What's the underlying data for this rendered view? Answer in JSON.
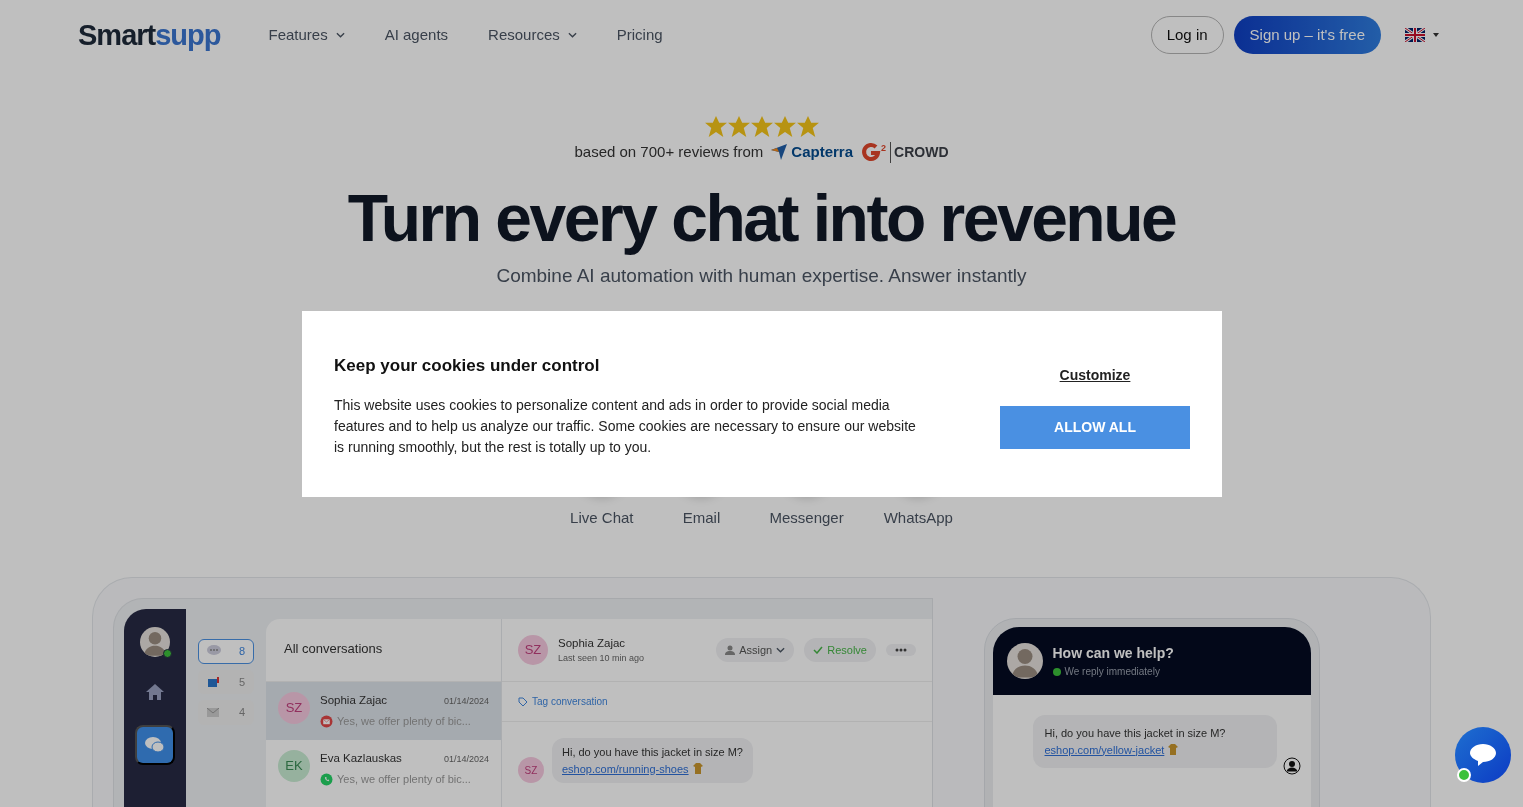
{
  "nav": {
    "logo_dark": "Smart",
    "logo_blue": "supp",
    "items": [
      {
        "label": "Features",
        "dropdown": true
      },
      {
        "label": "AI agents",
        "dropdown": false
      },
      {
        "label": "Resources",
        "dropdown": true
      },
      {
        "label": "Pricing",
        "dropdown": false
      }
    ],
    "login": "Log in",
    "signup": "Sign up – it's free"
  },
  "hero": {
    "stars": 5,
    "reviews_text": "based on 700+ reviews from",
    "capterra": "Capterra",
    "g2_mark": "2",
    "crowd": "CROWD",
    "title": "Turn every chat into revenue",
    "subtitle": "Combine AI automation with human expertise. Answer instantly"
  },
  "channels": [
    {
      "label": "Live Chat"
    },
    {
      "label": "Email"
    },
    {
      "label": "Messenger"
    },
    {
      "label": "WhatsApp"
    }
  ],
  "app": {
    "counts": [
      {
        "kind": "chat",
        "count": "8",
        "selected": true
      },
      {
        "kind": "mailbox",
        "count": "5",
        "selected": false
      },
      {
        "kind": "email",
        "count": "4",
        "selected": false
      }
    ],
    "list_title": "All conversations",
    "conversations": [
      {
        "initials": "SZ",
        "name": "Sophia Zajac",
        "date": "01/14/2024",
        "kind": "email",
        "preview": "Yes, we offer plenty of bic...",
        "selected": true
      },
      {
        "initials": "EK",
        "name": "Eva Kazlauskas",
        "date": "01/14/2024",
        "kind": "whatsapp",
        "preview": "Yes, we offer plenty of bic...",
        "selected": false
      }
    ],
    "chat": {
      "header_initials": "SZ",
      "message_initials": "SZ",
      "name": "Sophia Zajac",
      "last_seen": "Last seen 10 min ago",
      "assign": "Assign",
      "resolve": "Resolve",
      "tag": "Tag conversation",
      "message": "Hi, do you have this jacket in size M?",
      "link": "eshop.com/running-shoes"
    }
  },
  "widget": {
    "title": "How can we help?",
    "status": "We reply immediately",
    "online": true,
    "message": "Hi, do you have this jacket in size M?",
    "link": "eshop.com/yellow-jacket"
  },
  "cookie": {
    "title": "Keep your cookies under control",
    "text": "This website uses cookies to personalize content and ads in order to provide social media features and to help us analyze our traffic. Some cookies are necessary to ensure our website is running smoothly, but the rest is totally up to you.",
    "customize": "Customize",
    "allow": "ALLOW ALL"
  }
}
